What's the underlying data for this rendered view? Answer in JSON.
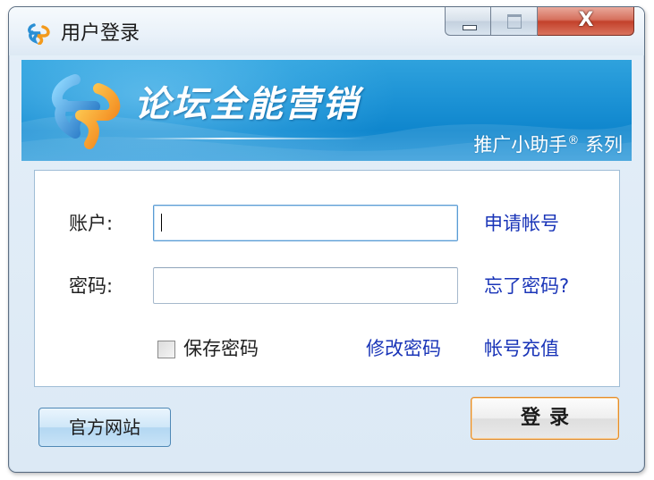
{
  "window": {
    "title": "用户登录",
    "close_symbol": "X"
  },
  "banner": {
    "product_name": "论坛全能营销",
    "series_text": "推广小助手",
    "series_mark": "®",
    "series_suffix": " 系列"
  },
  "form": {
    "account_label": "账户:",
    "account_value": "",
    "password_label": "密码:",
    "password_value": "",
    "remember_label": "保存密码",
    "remember_checked": false,
    "apply_account_link": "申请帐号",
    "forgot_password_link": "忘了密码?",
    "change_password_link": "修改密码",
    "recharge_link": "帐号充值"
  },
  "buttons": {
    "official_site": "官方网站",
    "login": "登录"
  },
  "colors": {
    "link": "#1a35b8",
    "banner": "#1c92d5",
    "close_button": "#c3412b",
    "login_border": "#e38b2a"
  },
  "icons": {
    "app_logo": "app-logo-icon",
    "minimize": "minimize-icon",
    "maximize": "maximize-icon",
    "close": "close-icon"
  }
}
